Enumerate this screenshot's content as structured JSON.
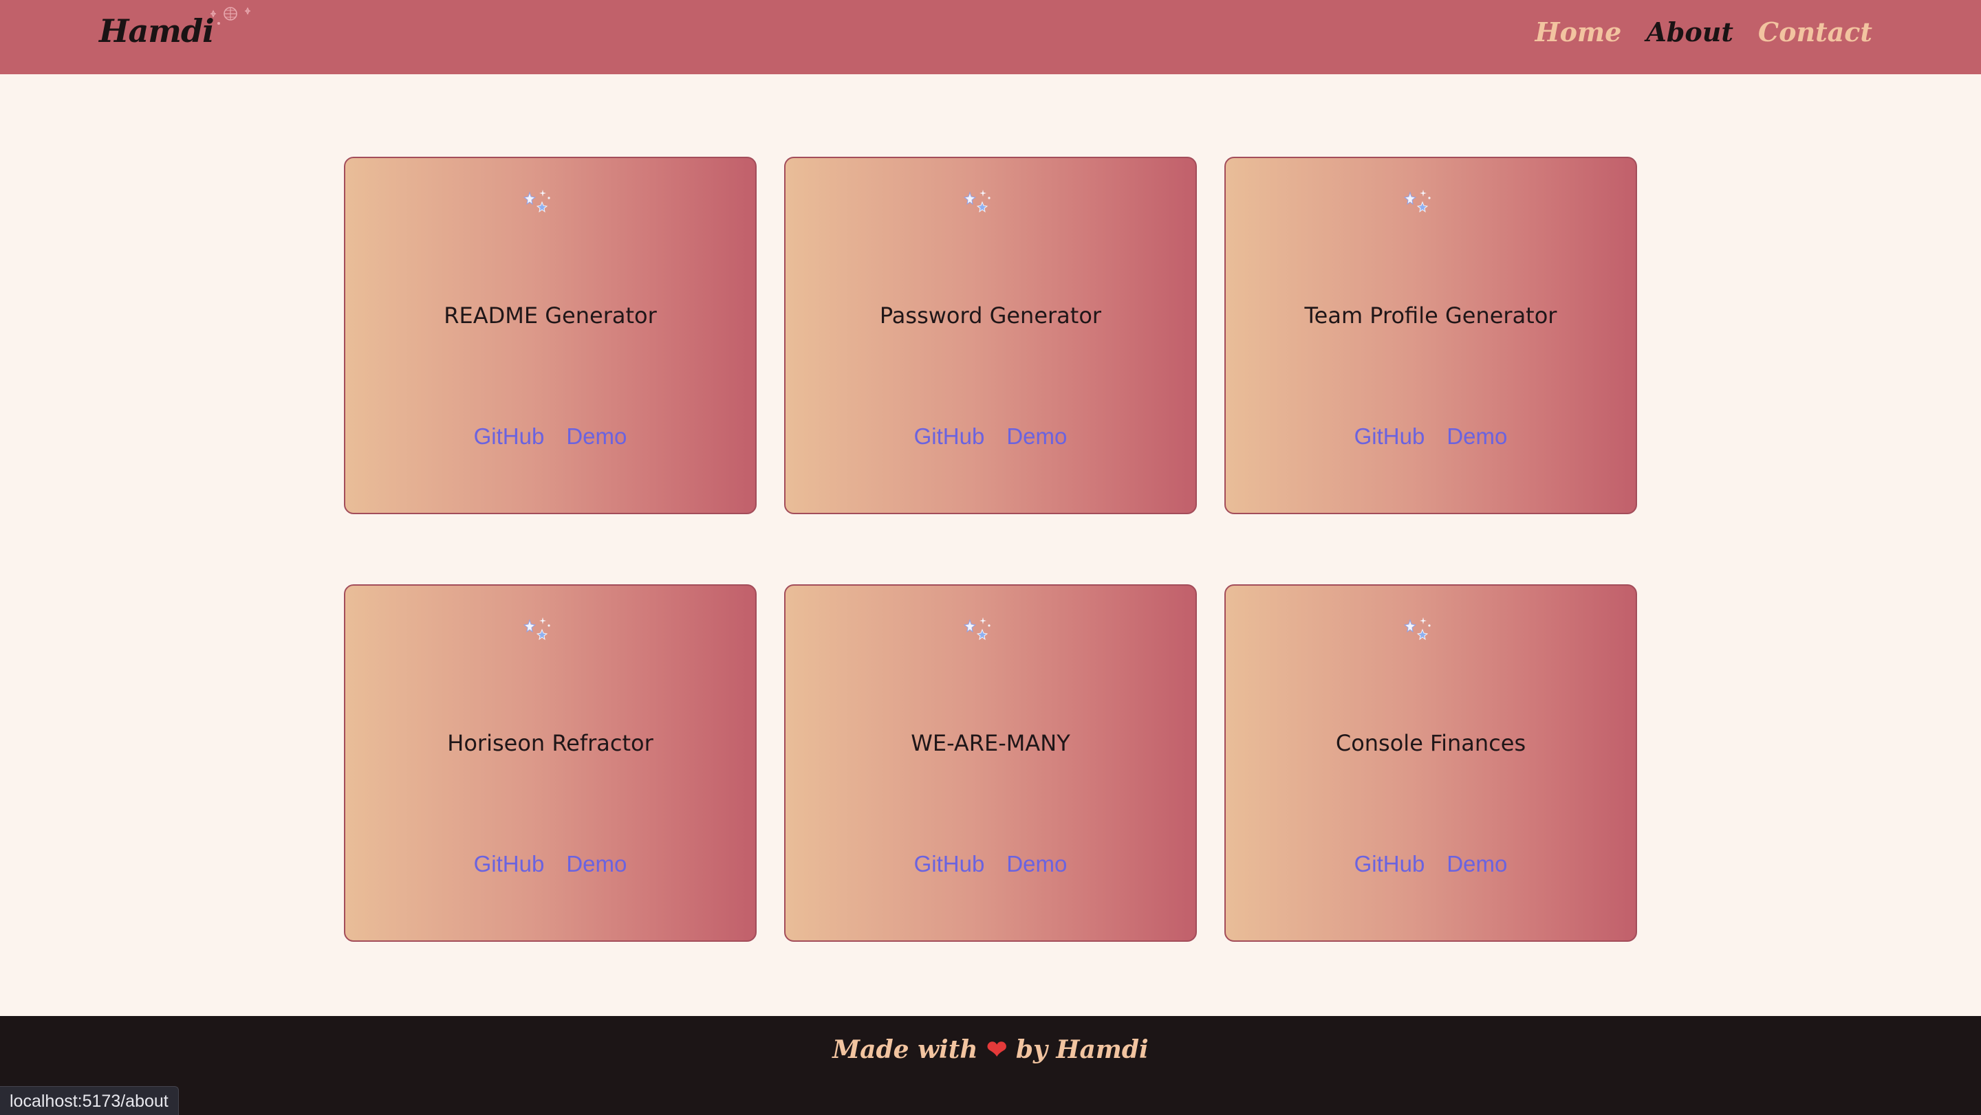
{
  "nav": {
    "brand": "Hamdi",
    "links": [
      {
        "label": "Home",
        "state": "inactive"
      },
      {
        "label": "About",
        "state": "active"
      },
      {
        "label": "Contact",
        "state": "inactive"
      }
    ]
  },
  "projects": [
    {
      "title": "README Generator",
      "github_label": "GitHub",
      "demo_label": "Demo"
    },
    {
      "title": "Password Generator",
      "github_label": "GitHub",
      "demo_label": "Demo"
    },
    {
      "title": "Team Profile Generator",
      "github_label": "GitHub",
      "demo_label": "Demo"
    },
    {
      "title": "Horiseon Refractor",
      "github_label": "GitHub",
      "demo_label": "Demo"
    },
    {
      "title": "WE-ARE-MANY",
      "github_label": "GitHub",
      "demo_label": "Demo"
    },
    {
      "title": "Console Finances",
      "github_label": "GitHub",
      "demo_label": "Demo"
    }
  ],
  "footer": {
    "text_before": "Made with",
    "heart": "❤",
    "text_after": "by Hamdi"
  },
  "status_bar": {
    "url": "localhost:5173/about"
  },
  "colors": {
    "navbar": "#c1616a",
    "page_background": "#fcf4ee",
    "card_gradient_start": "#e9bd98",
    "card_gradient_end": "#c1606b",
    "link": "#6a63e0",
    "nav_inactive": "#f2c4a0",
    "footer": "#1c1516"
  },
  "icons": {
    "brand_decoration": "disco-ball-icon",
    "card_icon": "sparkles-icon"
  }
}
